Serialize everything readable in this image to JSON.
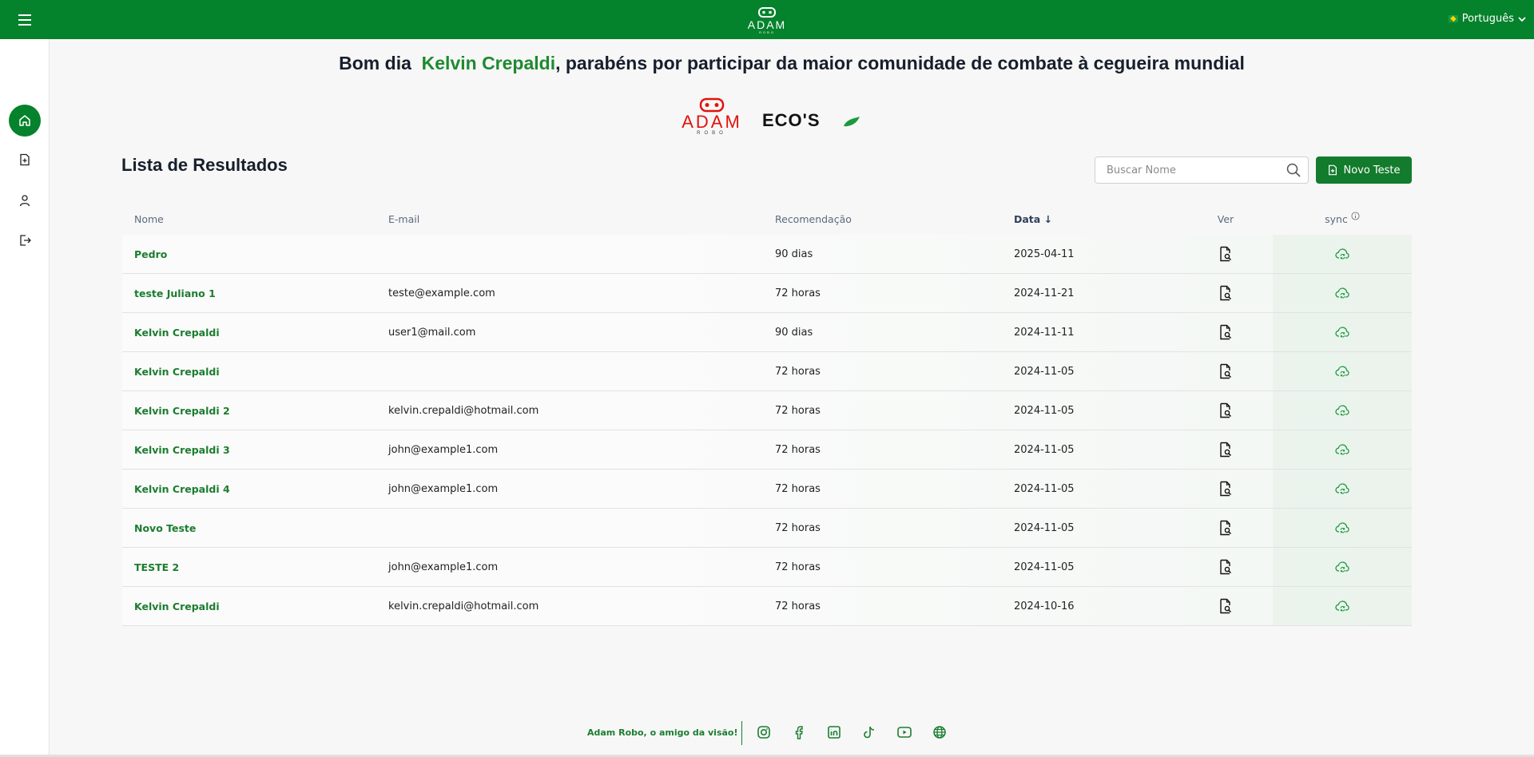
{
  "header": {
    "language": "Português"
  },
  "greeting": {
    "prefix": "Bom dia",
    "name": "Kelvin Crepaldi",
    "suffix": ", parabéns por participar da maior comunidade de combate à cegueira mundial"
  },
  "brand": {
    "logo1": "ADAM",
    "logo1_sub": "ROBO",
    "logo2": "ECO'S"
  },
  "results": {
    "title": "Lista de Resultados",
    "search_placeholder": "Buscar Nome",
    "new_test_label": "Novo Teste",
    "columns": {
      "name": "Nome",
      "email": "E-mail",
      "recommendation": "Recomendação",
      "date": "Data ↓",
      "view": "Ver",
      "sync": "sync"
    },
    "rows": [
      {
        "name": "Pedro",
        "email": "",
        "recommendation": "90 dias",
        "date": "2025-04-11"
      },
      {
        "name": "teste Juliano 1",
        "email": "teste@example.com",
        "recommendation": "72 horas",
        "date": "2024-11-21"
      },
      {
        "name": "Kelvin Crepaldi",
        "email": "user1@mail.com",
        "recommendation": "90 dias",
        "date": "2024-11-11"
      },
      {
        "name": "Kelvin Crepaldi",
        "email": "",
        "recommendation": "72 horas",
        "date": "2024-11-05"
      },
      {
        "name": "Kelvin Crepaldi 2",
        "email": "kelvin.crepaldi@hotmail.com",
        "recommendation": "72 horas",
        "date": "2024-11-05"
      },
      {
        "name": "Kelvin Crepaldi 3",
        "email": "john@example1.com",
        "recommendation": "72 horas",
        "date": "2024-11-05"
      },
      {
        "name": "Kelvin Crepaldi 4",
        "email": "john@example1.com",
        "recommendation": "72 horas",
        "date": "2024-11-05"
      },
      {
        "name": "Novo Teste",
        "email": "",
        "recommendation": "72 horas",
        "date": "2024-11-05"
      },
      {
        "name": "TESTE 2",
        "email": "john@example1.com",
        "recommendation": "72 horas",
        "date": "2024-11-05"
      },
      {
        "name": "Kelvin Crepaldi",
        "email": "kelvin.crepaldi@hotmail.com",
        "recommendation": "72 horas",
        "date": "2024-10-16"
      }
    ]
  },
  "footer": {
    "tagline": "Adam Robo, o amigo da visão!",
    "socials": [
      "instagram-icon",
      "facebook-icon",
      "linkedin-icon",
      "tiktok-icon",
      "youtube-icon",
      "globe-icon"
    ]
  },
  "colors": {
    "primary": "#05822c",
    "accent_text": "#1b7d2f",
    "logo_red": "#e3120b"
  }
}
